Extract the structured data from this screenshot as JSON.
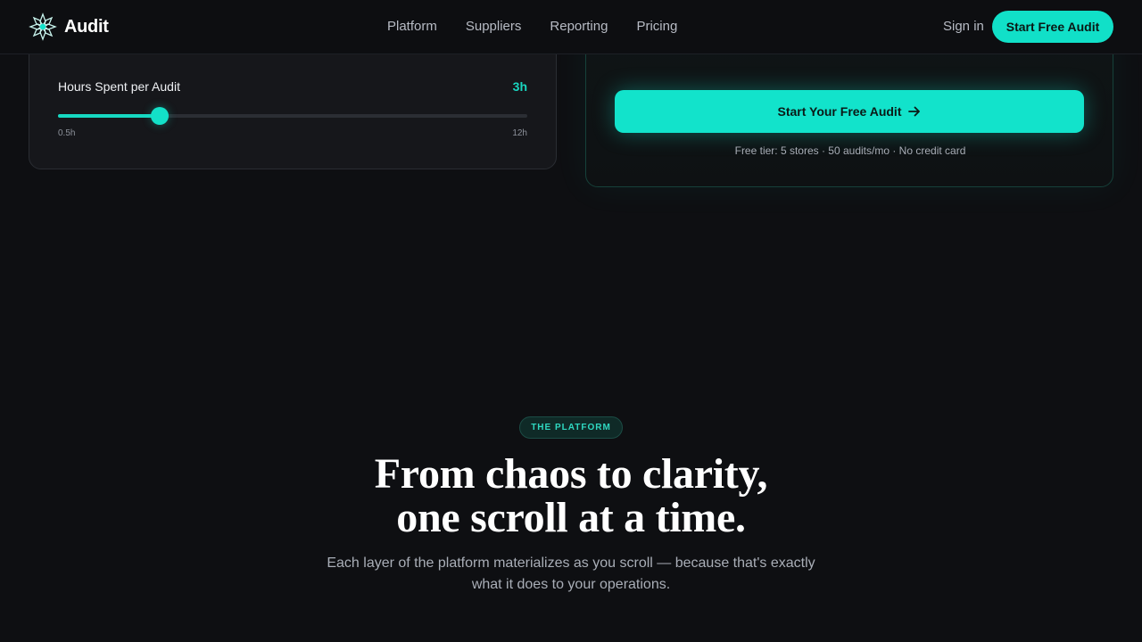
{
  "nav": {
    "brand": "Audit",
    "links": [
      "Platform",
      "Suppliers",
      "Reporting",
      "Pricing"
    ],
    "sign_in": "Sign in",
    "cta": "Start Free Audit"
  },
  "calculator": {
    "label": "Hours Spent per Audit",
    "value_text": "3h",
    "min_label": "0.5h",
    "max_label": "12h",
    "slider_value_hours": 3,
    "slider_min_hours": 0.5,
    "slider_max_hours": 12
  },
  "signup": {
    "cta": "Start Your Free Audit",
    "cta_icon": "arrow-right-icon",
    "fine_print": "Free tier: 5 stores · 50 audits/mo · No credit card"
  },
  "platform": {
    "eyebrow": "THE PLATFORM",
    "headline_line1": "From chaos to clarity,",
    "headline_line2": "one scroll at a time.",
    "subhead_line1": "Each layer of the platform materializes as you scroll — because that's exactly",
    "subhead_line2": "what it does to your operations."
  },
  "colors": {
    "accent": "#12e3cb",
    "background": "#0e0f12",
    "card": "#16171b"
  }
}
